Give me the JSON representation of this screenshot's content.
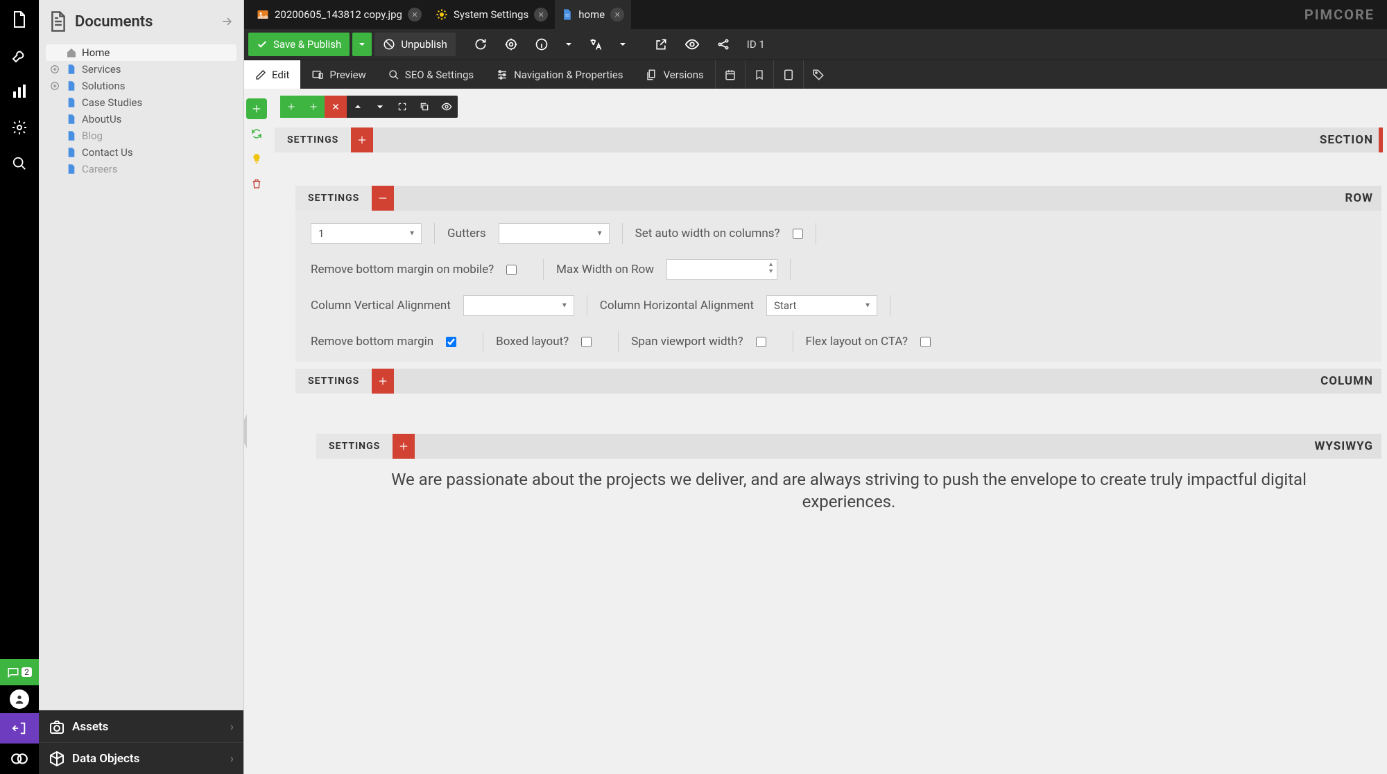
{
  "brand": "PIMCORE",
  "rail": {
    "notification_count": "2"
  },
  "sidebar": {
    "title": "Documents",
    "tree": [
      {
        "label": "Home",
        "type": "home",
        "active": true
      },
      {
        "label": "Services",
        "type": "doc",
        "expandable": true
      },
      {
        "label": "Solutions",
        "type": "doc",
        "expandable": true
      },
      {
        "label": "Case Studies",
        "type": "doc"
      },
      {
        "label": "AboutUs",
        "type": "doc"
      },
      {
        "label": "Blog",
        "type": "doc",
        "dim": true
      },
      {
        "label": "Contact Us",
        "type": "doc"
      },
      {
        "label": "Careers",
        "type": "doc",
        "dim": true
      }
    ],
    "bottom": [
      {
        "label": "Assets"
      },
      {
        "label": "Data Objects"
      }
    ]
  },
  "tabs": [
    {
      "label": "20200605_143812 copy.jpg",
      "icon": "image"
    },
    {
      "label": "System Settings",
      "icon": "gear"
    },
    {
      "label": "home",
      "icon": "doc",
      "active": true
    }
  ],
  "toolbar": {
    "save_publish": "Save & Publish",
    "unpublish": "Unpublish",
    "id_label": "ID 1"
  },
  "subnav": {
    "edit": "Edit",
    "preview": "Preview",
    "seo": "SEO & Settings",
    "nav": "Navigation & Properties",
    "versions": "Versions"
  },
  "editor": {
    "settings_label": "SETTINGS",
    "section_label": "SECTION",
    "row_label": "ROW",
    "column_label": "COLUMN",
    "wysiwyg_label": "WYSIWYG",
    "row_settings": {
      "columns_value": "1",
      "gutters_label": "Gutters",
      "auto_width_label": "Set auto width on columns?",
      "auto_width_checked": false,
      "remove_margin_mobile_label": "Remove bottom margin on mobile?",
      "remove_margin_mobile_checked": false,
      "max_width_label": "Max Width on Row",
      "col_valign_label": "Column Vertical Alignment",
      "col_halign_label": "Column Horizontal Alignment",
      "col_halign_value": "Start",
      "remove_bottom_margin_label": "Remove bottom margin",
      "remove_bottom_margin_checked": true,
      "boxed_label": "Boxed layout?",
      "boxed_checked": false,
      "span_viewport_label": "Span viewport width?",
      "span_viewport_checked": false,
      "flex_cta_label": "Flex layout on CTA?",
      "flex_cta_checked": false
    },
    "wysiwyg_text": "We are passionate about the projects we deliver, and are always striving to push the envelope to create truly impactful digital experiences."
  }
}
